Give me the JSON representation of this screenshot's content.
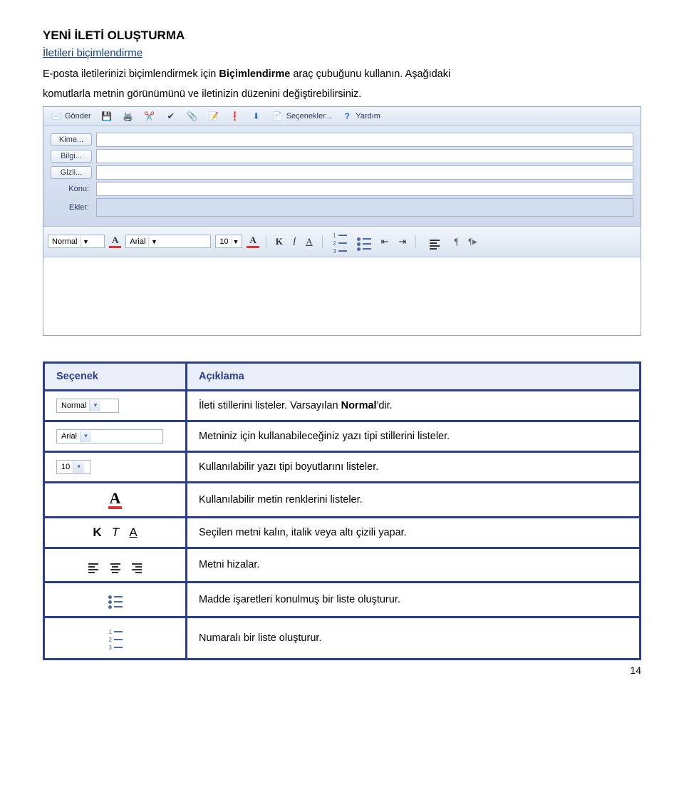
{
  "heading": "YENİ İLETİ OLUŞTURMA",
  "subheading": "İletileri biçimlendirme",
  "paragraph_parts": {
    "p1": "E-posta iletilerinizi biçimlendirmek için ",
    "p1_bold": "Biçimlendirme",
    "p1_after": " araç çubuğunu kullanın. Aşağıdaki",
    "p2": "komutlarla metnin görünümünü ve iletinizin düzenini değiştirebilirsiniz."
  },
  "compose": {
    "toolbar": {
      "send": "Gönder",
      "options": "Seçenekler...",
      "help": "Yardım"
    },
    "fields": {
      "to": "Kime...",
      "cc": "Bilgi...",
      "bcc": "Gizli...",
      "subject": "Konu:",
      "attachments": "Ekler:"
    },
    "format": {
      "style": "Normal",
      "font": "Arial",
      "size": "10",
      "bold": "K",
      "italic": "İ",
      "underline": "A"
    }
  },
  "table": {
    "header_option": "Seçenek",
    "header_desc": "Açıklama",
    "rows": [
      {
        "icon_kind": "dd-normal",
        "icon_label": "Normal",
        "desc_prefix": "İleti stillerini listeler. ",
        "desc_plain": "Varsayılan ",
        "desc_bold": "Normal",
        "desc_suffix": "'dir."
      },
      {
        "icon_kind": "dd-arial",
        "icon_label": "Arial",
        "desc": "Metniniz için kullanabileceğiniz yazı tipi stillerini listeler."
      },
      {
        "icon_kind": "dd-10",
        "icon_label": "10",
        "desc": "Kullanılabilir yazı tipi boyutlarını listeler."
      },
      {
        "icon_kind": "font-color",
        "desc": "Kullanılabilir metin renklerini listeler."
      },
      {
        "icon_kind": "kta",
        "k": "K",
        "t": "T",
        "a": "A",
        "desc": "Seçilen metni kalın, italik veya altı çizili yapar."
      },
      {
        "icon_kind": "align",
        "desc": "Metni hizalar."
      },
      {
        "icon_kind": "bullets",
        "desc": "Madde işaretleri konulmuş bir liste oluşturur."
      },
      {
        "icon_kind": "numbers",
        "desc": "Numaralı bir liste oluşturur."
      }
    ]
  },
  "page_number": "14"
}
